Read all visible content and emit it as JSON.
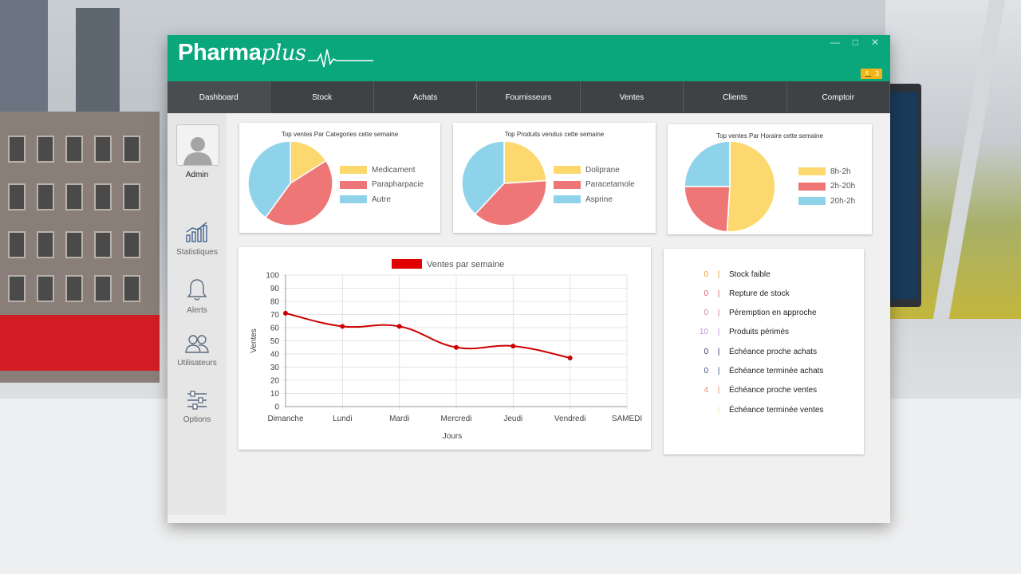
{
  "app": {
    "brand_main": "Pharma",
    "brand_accent": "plus",
    "notification_count": "3",
    "colors": {
      "primary": "#0aa77d",
      "nav": "#3f4244",
      "notif": "#f2b417"
    }
  },
  "nav": {
    "items": [
      "Dashboard",
      "Stock",
      "Achats",
      "Fournisseurs",
      "Ventes",
      "Clients",
      "Comptoir"
    ],
    "active": "Dashboard"
  },
  "sidebar": {
    "user": "Admin",
    "items": [
      {
        "label": "Statistiques",
        "icon": "chart-icon"
      },
      {
        "label": "Alerts",
        "icon": "bell-icon"
      },
      {
        "label": "Utilisateurs",
        "icon": "users-icon"
      },
      {
        "label": "Options",
        "icon": "sliders-icon"
      }
    ]
  },
  "pies": [
    {
      "title": "Top ventes Par Categories cette semaine",
      "chart_data": {
        "type": "pie",
        "labels": [
          "Medicament",
          "Parapharpacie",
          "Autre"
        ],
        "values": [
          16,
          44,
          40
        ],
        "colors": [
          "#fcd86e",
          "#ef7676",
          "#8fd3eb"
        ]
      }
    },
    {
      "title": "Top Produits vendus cette semaine",
      "chart_data": {
        "type": "pie",
        "labels": [
          "Doliprane",
          "Paracetamole",
          "Asprine"
        ],
        "values": [
          24,
          38,
          38
        ],
        "colors": [
          "#fcd86e",
          "#ef7676",
          "#8fd3eb"
        ]
      }
    },
    {
      "title": "Top ventes Par Horaire cette semaine",
      "chart_data": {
        "type": "pie",
        "labels": [
          "8h-2h",
          "2h-20h",
          "20h-2h"
        ],
        "values": [
          51,
          24,
          25
        ],
        "colors": [
          "#fcd86e",
          "#ef7676",
          "#8fd3eb"
        ]
      }
    }
  ],
  "chart_data": {
    "type": "line",
    "legend": "Ventes par semaine",
    "legend_color": "#e00000",
    "categories": [
      "Dimanche",
      "Lundi",
      "Mardi",
      "Mercredi",
      "Jeudi",
      "Vendredi",
      "SAMEDI"
    ],
    "series": [
      {
        "name": "Ventes par semaine",
        "values": [
          71,
          61,
          61,
          45,
          46,
          37
        ]
      }
    ],
    "xlabel": "Jours",
    "ylabel": "Ventes",
    "ylim": [
      0,
      100
    ],
    "yticks": [
      0,
      10,
      20,
      30,
      40,
      50,
      60,
      70,
      80,
      90,
      100
    ],
    "grid": true,
    "line_color": "#cc0000"
  },
  "alerts": [
    {
      "count": "0",
      "label": "Stock faible",
      "color": "#f0a020"
    },
    {
      "count": "0",
      "label": "Repture de stock",
      "color": "#e05a6a"
    },
    {
      "count": "0",
      "label": "Péremption en approche",
      "color": "#d27aa0"
    },
    {
      "count": "10",
      "label": "Produits périmés",
      "color": "#c78fe0"
    },
    {
      "count": "0",
      "label": "Échéance proche achats",
      "color": "#2e2e5a"
    },
    {
      "count": "0",
      "label": "Échéance terminée achats",
      "color": "#3a4a7a"
    },
    {
      "count": "4",
      "label": "Échéance proche ventes",
      "color": "#f08a6a"
    },
    {
      "count": "",
      "label": "Échéance terminée ventes",
      "color": "#f7e7a0"
    }
  ]
}
